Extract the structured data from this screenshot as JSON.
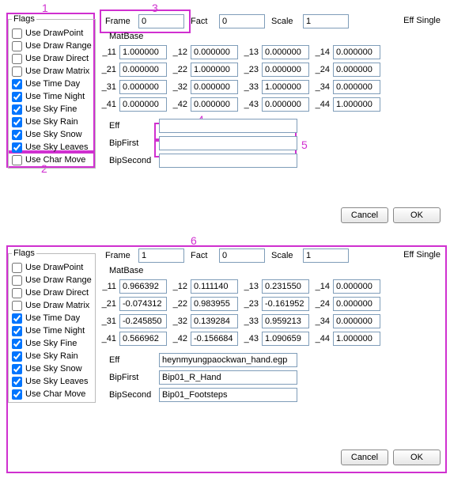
{
  "callouts": {
    "c1": "1",
    "c2": "2",
    "c3": "3",
    "c4": "4",
    "c5": "5",
    "c6": "6"
  },
  "panel1": {
    "title": "Eff Single",
    "flags_legend": "Flags",
    "flags": [
      {
        "label": "Use DrawPoint",
        "checked": false
      },
      {
        "label": "Use Draw Range",
        "checked": false
      },
      {
        "label": "Use Draw Direct",
        "checked": false
      },
      {
        "label": "Use Draw Matrix",
        "checked": false
      },
      {
        "label": "Use Time Day",
        "checked": true
      },
      {
        "label": "Use Time Night",
        "checked": true
      },
      {
        "label": "Use Sky Fine",
        "checked": true
      },
      {
        "label": "Use Sky Rain",
        "checked": true
      },
      {
        "label": "Use Sky Snow",
        "checked": true
      },
      {
        "label": "Use Sky Leaves",
        "checked": true
      },
      {
        "label": "Use Char Move",
        "checked": false
      }
    ],
    "top": {
      "frame_label": "Frame",
      "frame_value": "0",
      "fact_label": "Fact",
      "fact_value": "0",
      "scale_label": "Scale",
      "scale_value": "1"
    },
    "matbase_label": "MatBase",
    "matrix": {
      "_11": "1.000000",
      "_12": "0.000000",
      "_13": "0.000000",
      "_14": "0.000000",
      "_21": "0.000000",
      "_22": "1.000000",
      "_23": "0.000000",
      "_24": "0.000000",
      "_31": "0.000000",
      "_32": "0.000000",
      "_33": "1.000000",
      "_34": "0.000000",
      "_41": "0.000000",
      "_42": "0.000000",
      "_43": "0.000000",
      "_44": "1.000000"
    },
    "binds": {
      "eff_label": "Eff",
      "eff_value": "",
      "bipfirst_label": "BipFirst",
      "bipfirst_value": "",
      "bipsecond_label": "BipSecond",
      "bipsecond_value": ""
    },
    "buttons": {
      "cancel": "Cancel",
      "ok": "OK"
    }
  },
  "panel2": {
    "title": "Eff Single",
    "flags_legend": "Flags",
    "flags": [
      {
        "label": "Use DrawPoint",
        "checked": false
      },
      {
        "label": "Use Draw Range",
        "checked": false
      },
      {
        "label": "Use Draw Direct",
        "checked": false
      },
      {
        "label": "Use Draw Matrix",
        "checked": false
      },
      {
        "label": "Use Time Day",
        "checked": true
      },
      {
        "label": "Use Time Night",
        "checked": true
      },
      {
        "label": "Use Sky Fine",
        "checked": true
      },
      {
        "label": "Use Sky Rain",
        "checked": true
      },
      {
        "label": "Use Sky Snow",
        "checked": true
      },
      {
        "label": "Use Sky Leaves",
        "checked": true
      },
      {
        "label": "Use Char Move",
        "checked": true
      }
    ],
    "top": {
      "frame_label": "Frame",
      "frame_value": "1",
      "fact_label": "Fact",
      "fact_value": "0",
      "scale_label": "Scale",
      "scale_value": "1"
    },
    "matbase_label": "MatBase",
    "matrix": {
      "_11": "0.966392",
      "_12": "0.111140",
      "_13": "0.231550",
      "_14": "0.000000",
      "_21": "-0.074312",
      "_22": "0.983955",
      "_23": "-0.161952",
      "_24": "0.000000",
      "_31": "-0.245850",
      "_32": "0.139284",
      "_33": "0.959213",
      "_34": "0.000000",
      "_41": "0.566962",
      "_42": "-0.156684",
      "_43": "1.090659",
      "_44": "1.000000"
    },
    "binds": {
      "eff_label": "Eff",
      "eff_value": "heynmyungpaockwan_hand.egp",
      "bipfirst_label": "BipFirst",
      "bipfirst_value": "Bip01_R_Hand",
      "bipsecond_label": "BipSecond",
      "bipsecond_value": "Bip01_Footsteps"
    },
    "buttons": {
      "cancel": "Cancel",
      "ok": "OK"
    }
  }
}
